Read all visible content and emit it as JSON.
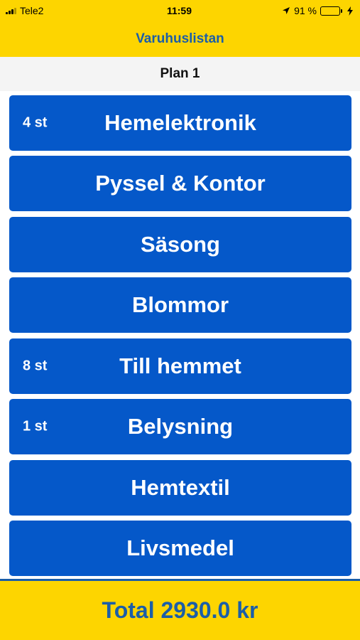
{
  "status_bar": {
    "carrier": "Tele2",
    "time": "11:59",
    "battery_percent": "91 %",
    "battery_level": 0.91,
    "battery_color": "#4cd964"
  },
  "nav": {
    "title": "Varuhuslistan"
  },
  "plan": {
    "title": "Plan 1"
  },
  "categories": [
    {
      "label": "Hemelektronik",
      "count": "4 st"
    },
    {
      "label": "Pyssel & Kontor",
      "count": ""
    },
    {
      "label": "Säsong",
      "count": ""
    },
    {
      "label": "Blommor",
      "count": ""
    },
    {
      "label": "Till hemmet",
      "count": "8 st"
    },
    {
      "label": "Belysning",
      "count": "1 st"
    },
    {
      "label": "Hemtextil",
      "count": ""
    },
    {
      "label": "Livsmedel",
      "count": ""
    }
  ],
  "footer": {
    "total": "Total 2930.0 kr"
  },
  "colors": {
    "brand_yellow": "#fdd500",
    "brand_blue": "#1b5ea8",
    "button_blue": "#0558c9"
  },
  "icons": [
    "signal-icon",
    "location-arrow-icon",
    "battery-icon",
    "charging-bolt-icon"
  ]
}
